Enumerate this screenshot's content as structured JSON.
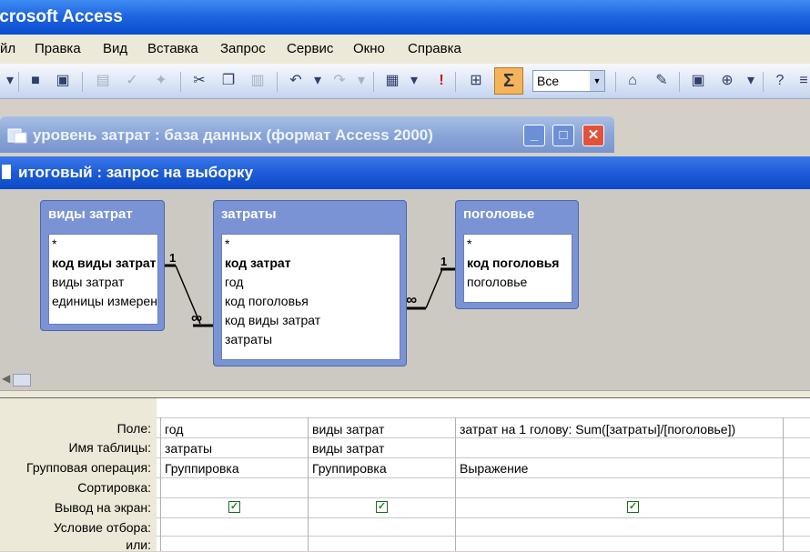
{
  "app_title": "icrosoft Access",
  "menu": [
    {
      "label": "йл"
    },
    {
      "label": "Правка"
    },
    {
      "label": "Вид"
    },
    {
      "label": "Вставка"
    },
    {
      "label": "Запрос"
    },
    {
      "label": "Сервис"
    },
    {
      "label": "Окно"
    },
    {
      "label": "Справка"
    }
  ],
  "toolbar": {
    "sigma_label": "Σ",
    "top_values": "Все",
    "icons": [
      "save-icon",
      "print-preview-icon",
      "print-icon",
      "spelling-icon",
      "cut-icon",
      "copy-icon",
      "paste-icon",
      "undo-icon",
      "redo-icon",
      "query-type-icon",
      "run-icon",
      "show-table-icon",
      "totals-icon",
      "properties-icon",
      "builder-icon",
      "database-window-icon",
      "new-object-icon",
      "help-icon"
    ]
  },
  "db_window": {
    "title": "уровень затрат : база данных (формат Access 2000)"
  },
  "query_window": {
    "title": "итоговый : запрос на выборку"
  },
  "tables": [
    {
      "title": "виды затрат",
      "fields": [
        "*",
        "код виды затрат",
        "виды затрат",
        "единицы измерения"
      ]
    },
    {
      "title": "затраты",
      "fields": [
        "*",
        "код затрат",
        "год",
        "код поголовья",
        "код виды затрат",
        "затраты"
      ]
    },
    {
      "title": "поголовье",
      "fields": [
        "*",
        "код поголовья",
        "поголовье"
      ]
    }
  ],
  "relations": [
    {
      "one": "1",
      "many": "∞"
    },
    {
      "one": "1",
      "many": "∞"
    }
  ],
  "grid": {
    "row_labels": [
      "Поле:",
      "Имя таблицы:",
      "Групповая операция:",
      "Сортировка:",
      "Вывод на экран:",
      "Условие отбора:",
      "или:"
    ],
    "columns": [
      {
        "field": "год",
        "table": "затраты",
        "group": "Группировка",
        "sort": "",
        "show": true,
        "criteria": "",
        "or": ""
      },
      {
        "field": "виды затрат",
        "table": "виды затрат",
        "group": "Группировка",
        "sort": "",
        "show": true,
        "criteria": "",
        "or": ""
      },
      {
        "field": "затрат на 1 голову: Sum([затраты]/[поголовье])",
        "table": "",
        "group": "Выражение",
        "sort": "",
        "show": true,
        "criteria": "",
        "or": ""
      }
    ]
  },
  "colors": {
    "accent": "#1d5cd8",
    "table_header": "#7a93d4",
    "sigma_active": "#f4b45c"
  }
}
